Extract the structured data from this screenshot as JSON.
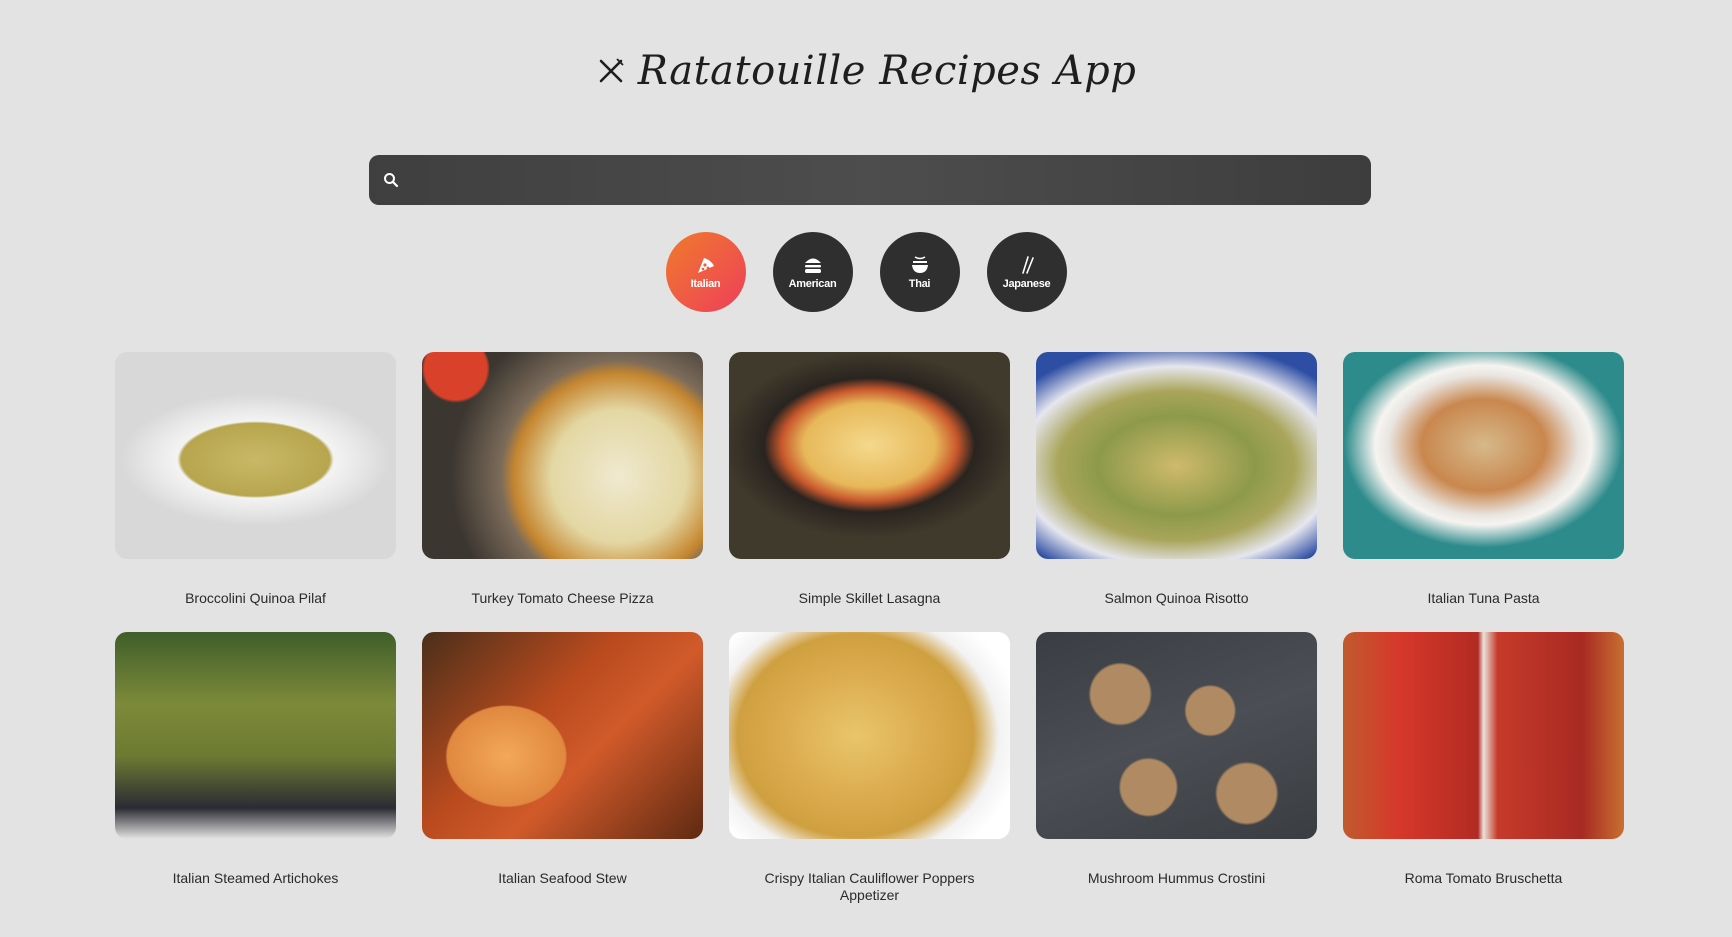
{
  "app": {
    "title": "Ratatouille Recipes App",
    "logo_icon": "fork-knife-icon"
  },
  "search": {
    "value": "",
    "placeholder": "",
    "icon": "search-icon"
  },
  "colors": {
    "background": "#e3e3e3",
    "pill_inactive": "#2f2f2f",
    "pill_active_start": "#f07a2c",
    "pill_active_end": "#ee3f5a"
  },
  "categories": [
    {
      "label": "Italian",
      "icon": "pizza-icon",
      "active": true
    },
    {
      "label": "American",
      "icon": "burger-icon",
      "active": false
    },
    {
      "label": "Thai",
      "icon": "noodle-bowl-icon",
      "active": false
    },
    {
      "label": "Japanese",
      "icon": "chopsticks-icon",
      "active": false
    }
  ],
  "recipes": [
    {
      "title": "Broccolini Quinoa Pilaf"
    },
    {
      "title": "Turkey Tomato Cheese Pizza"
    },
    {
      "title": "Simple Skillet Lasagna"
    },
    {
      "title": "Salmon Quinoa Risotto"
    },
    {
      "title": "Italian Tuna Pasta"
    },
    {
      "title": "Italian Steamed Artichokes"
    },
    {
      "title": "Italian Seafood Stew"
    },
    {
      "title": "Crispy Italian Cauliflower Poppers Appetizer"
    },
    {
      "title": "Mushroom Hummus Crostini"
    },
    {
      "title": "Roma Tomato Bruschetta"
    }
  ]
}
